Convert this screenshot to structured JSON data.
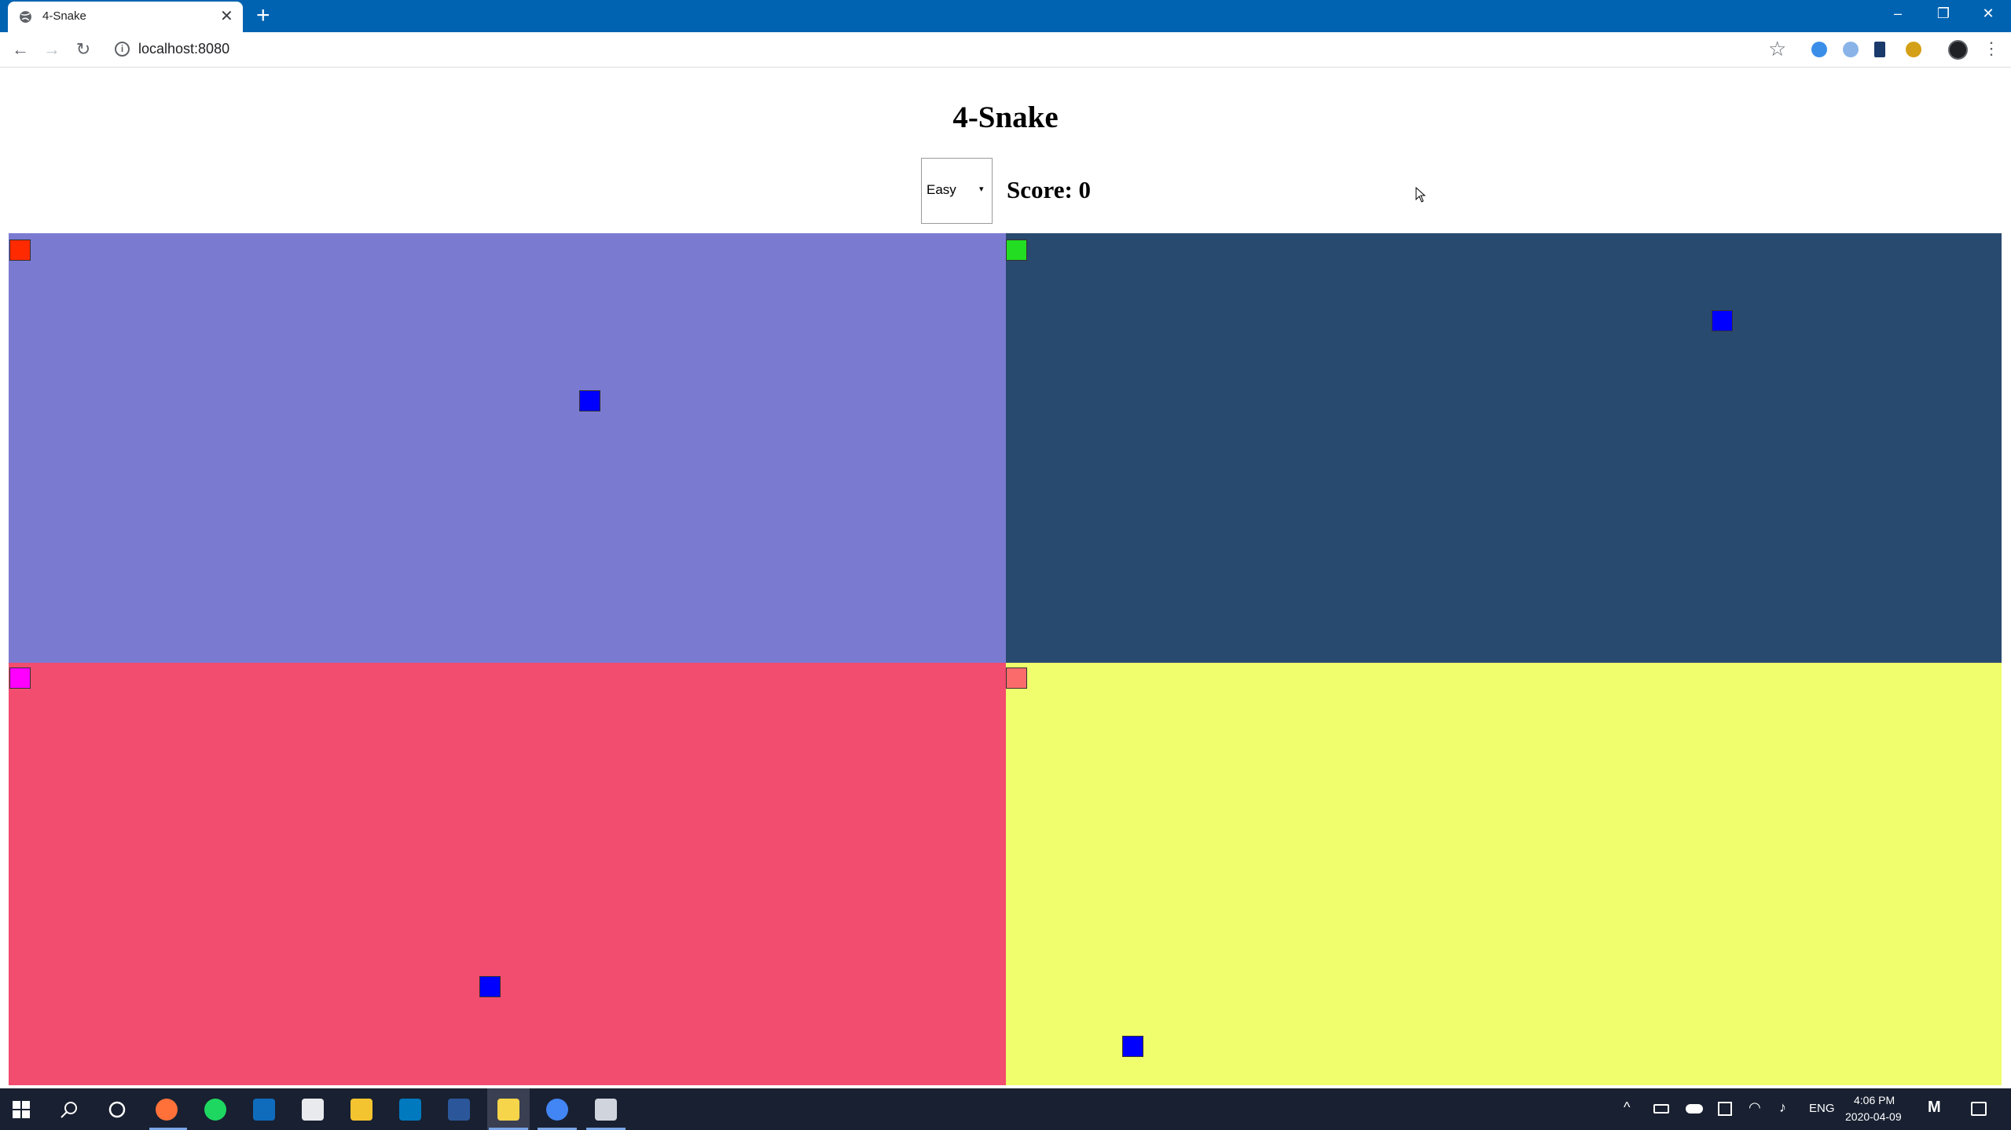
{
  "browser": {
    "tab_title": "4-Snake",
    "tab_close": "✕",
    "new_tab": "+",
    "url": "localhost:8080",
    "window_controls": {
      "minimize": "–",
      "restore": "❐",
      "close": "✕"
    }
  },
  "page": {
    "title": "4-Snake",
    "difficulty": {
      "selected": "Easy",
      "arrow": "▾"
    },
    "score_label": "Score: 0"
  },
  "boards": [
    {
      "name": "top-left",
      "color": "#7b7ad1",
      "snake_color": "#ff2a00",
      "food_color": "#0000ff"
    },
    {
      "name": "top-right",
      "color": "#294a6f",
      "snake_color": "#22dd22",
      "food_color": "#0000ff"
    },
    {
      "name": "bottom-left",
      "color": "#f24c6f",
      "snake_color": "#ff00ff",
      "food_color": "#0000ff"
    },
    {
      "name": "bottom-right",
      "color": "#f0fd6c",
      "snake_color": "#fb6b6b",
      "food_color": "#0000ff"
    }
  ],
  "taskbar": {
    "language": "ENG",
    "time": "4:06 PM",
    "date": "2020-04-09",
    "icons": [
      "windows-start-icon",
      "search-icon",
      "cortana-icon",
      "firefox-icon",
      "spotify-icon",
      "outlook-icon",
      "store-icon",
      "file-explorer-icon",
      "trello-icon",
      "word-icon",
      "sticky-notes-icon",
      "chrome-icon",
      "terminal-icon"
    ]
  }
}
